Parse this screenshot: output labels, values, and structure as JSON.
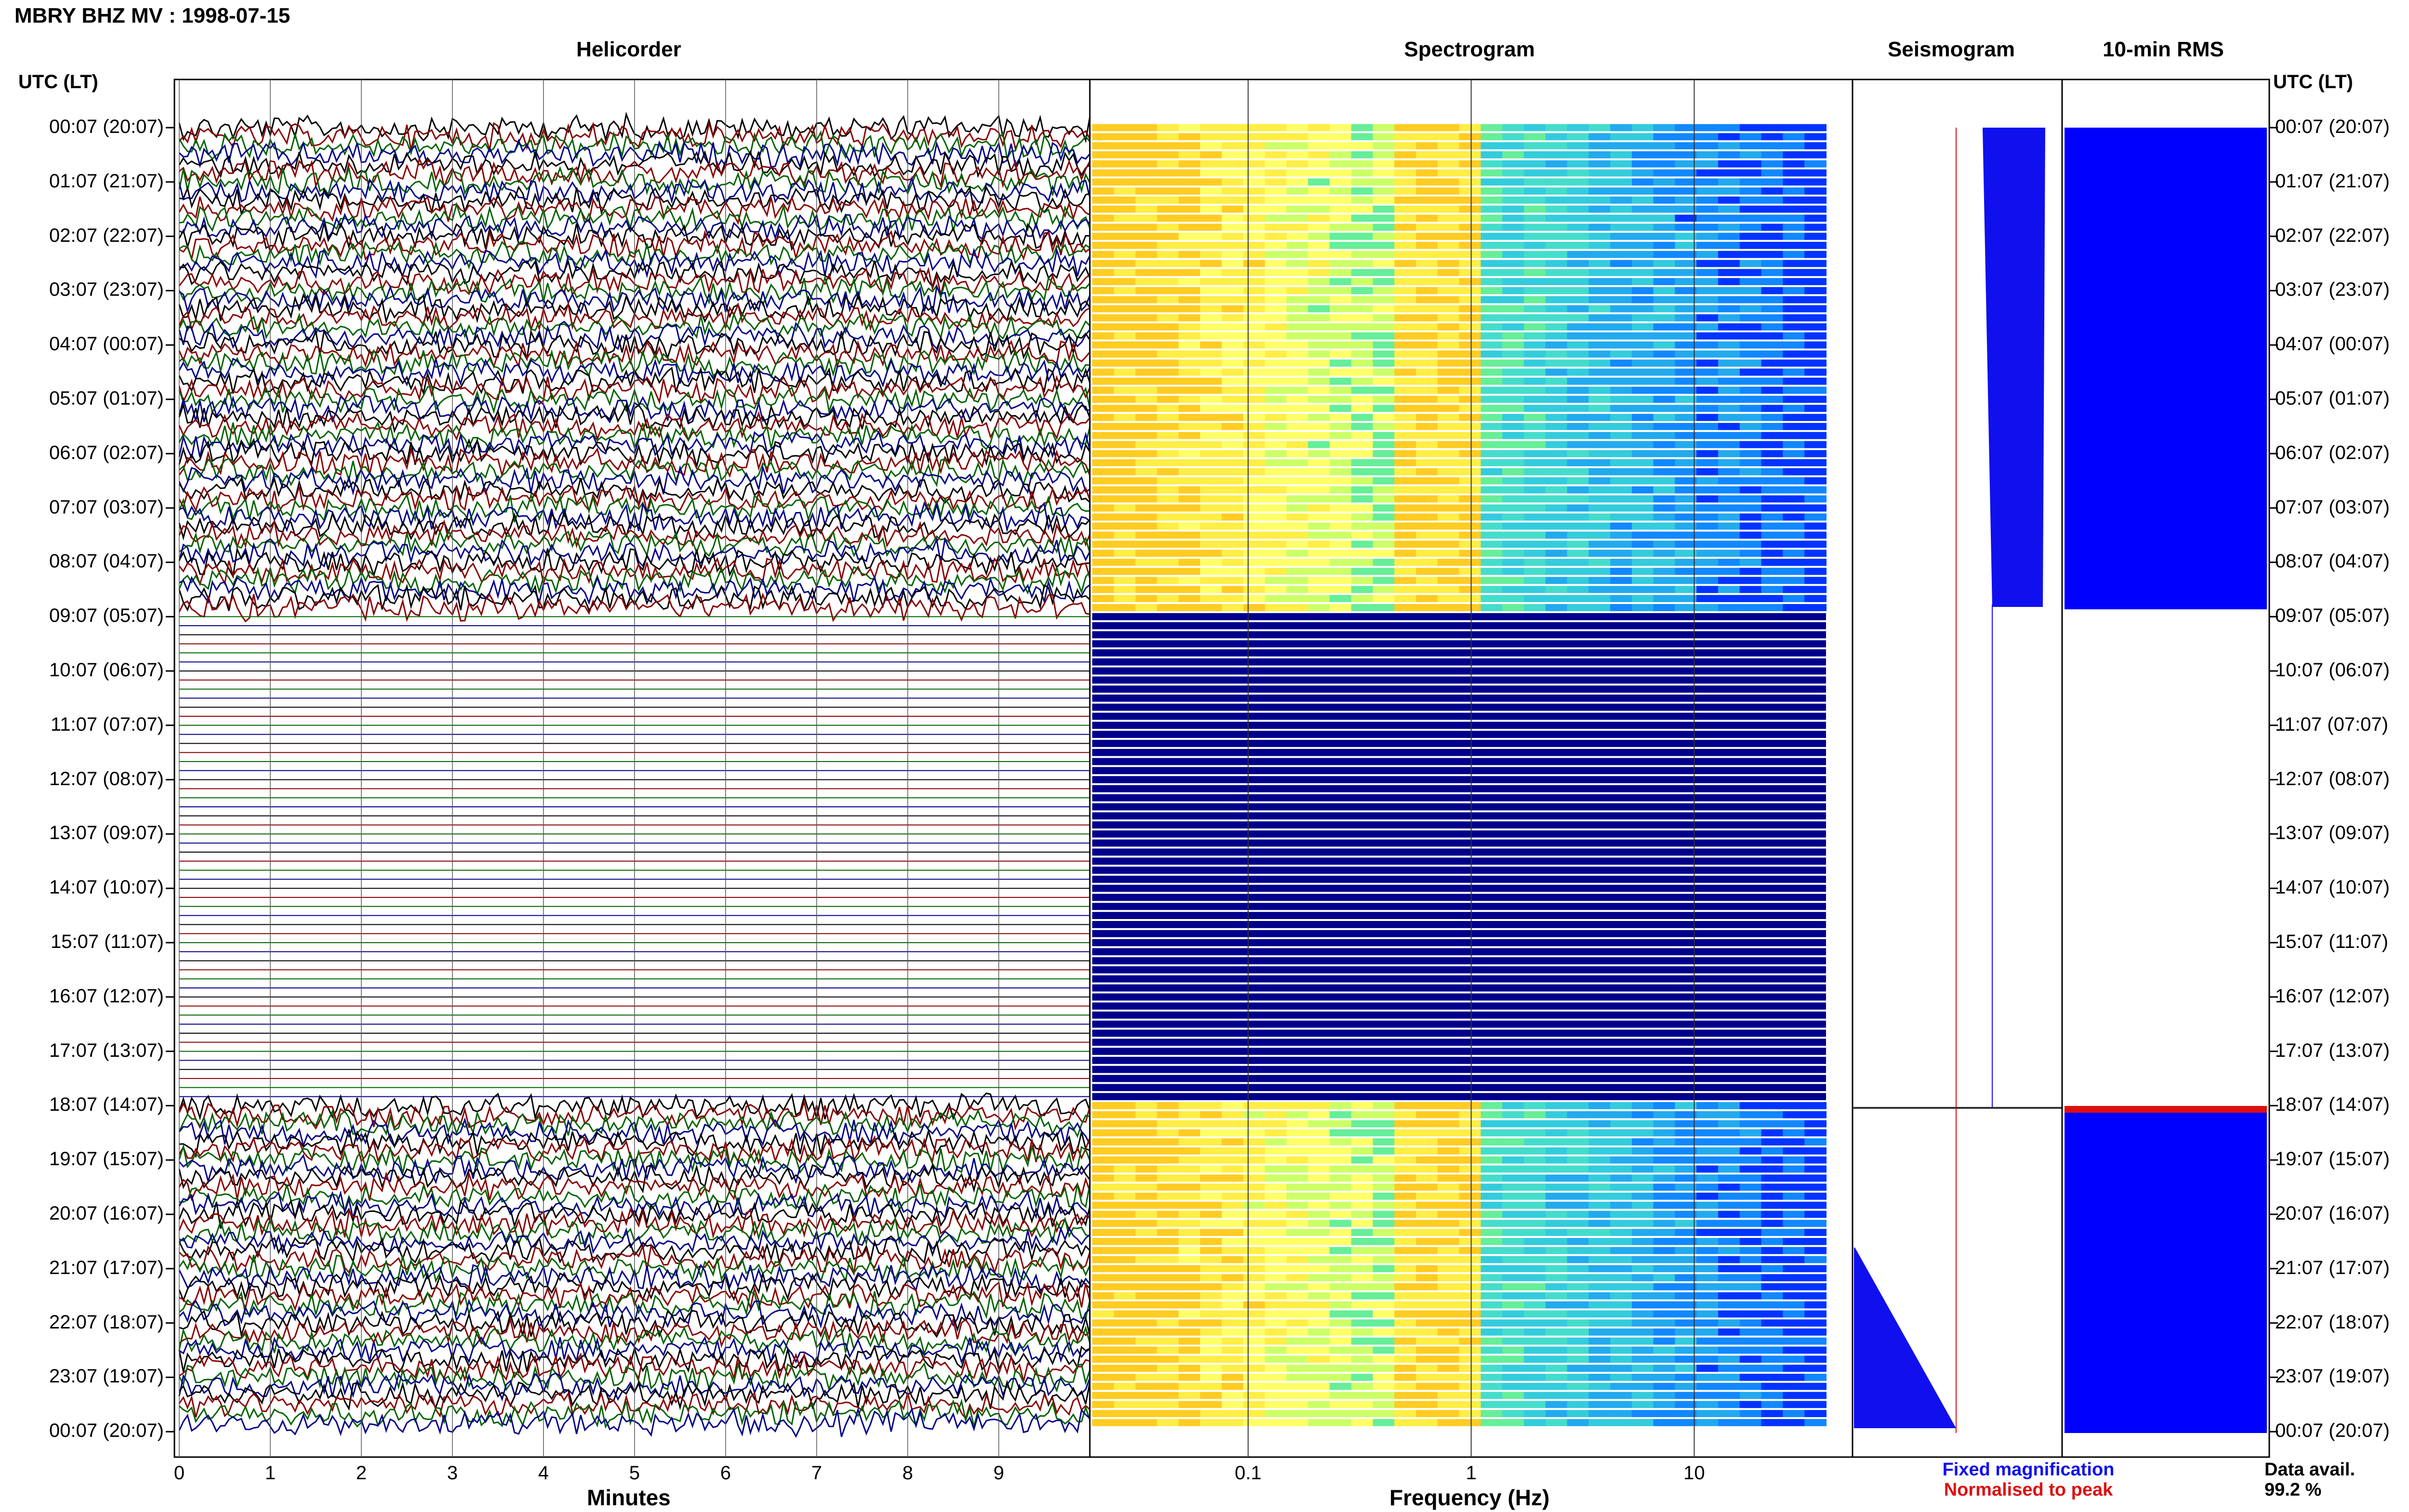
{
  "header": {
    "title": "MBRY BHZ MV : 1998-07-15",
    "corner_left": "UTC (LT)",
    "corner_right": "UTC (LT)"
  },
  "panels": {
    "helicorder": "Helicorder",
    "spectrogram": "Spectrogram",
    "seismogram": "Seismogram",
    "rms": "10-min RMS"
  },
  "legend": {
    "fixed": "Fixed magnification",
    "normalised": "Normalised to peak",
    "data_avail_label": "Data avail.",
    "data_avail_value": "99.2 %"
  },
  "colors": {
    "fixed": "#1010ee",
    "normalised": "#dd1010",
    "trace_colors": [
      "#000000",
      "#8b0000",
      "#006400",
      "#00008b"
    ],
    "spectrogram_gap": "#00008b",
    "rms_bar": "#0000ff"
  },
  "chart_data": [
    {
      "type": "line",
      "name": "helicorder",
      "title": "Helicorder",
      "xlabel": "Minutes",
      "x_ticks": [
        "0",
        "1",
        "2",
        "3",
        "4",
        "5",
        "6",
        "7",
        "8",
        "9"
      ],
      "xlim": [
        0,
        10
      ],
      "time_labels_utc_lt": [
        "00:07 (20:07)",
        "01:07 (21:07)",
        "02:07 (22:07)",
        "03:07 (23:07)",
        "04:07 (00:07)",
        "05:07 (01:07)",
        "06:07 (02:07)",
        "07:07 (03:07)",
        "08:07 (04:07)",
        "09:07 (05:07)",
        "10:07 (06:07)",
        "11:07 (07:07)",
        "12:07 (08:07)",
        "13:07 (09:07)",
        "14:07 (10:07)",
        "15:07 (11:07)",
        "16:07 (12:07)",
        "17:07 (13:07)",
        "18:07 (14:07)",
        "19:07 (15:07)",
        "20:07 (16:07)",
        "21:07 (17:07)",
        "22:07 (18:07)",
        "23:07 (19:07)",
        "00:07 (20:07)"
      ],
      "rows_per_hour": 6,
      "data_gap_hours": [
        9,
        18
      ]
    },
    {
      "type": "heatmap",
      "name": "spectrogram",
      "title": "Spectrogram",
      "xlabel": "Frequency (Hz)",
      "x_scale": "log",
      "x_ticks": [
        "0.1",
        "1",
        "10"
      ],
      "xlim": [
        0.02,
        50
      ],
      "data_gap_hours": [
        9,
        18
      ]
    },
    {
      "type": "line",
      "name": "seismogram",
      "title": "Seismogram",
      "series": [
        {
          "name": "Fixed magnification"
        },
        {
          "name": "Normalised to peak"
        }
      ]
    },
    {
      "type": "bar",
      "name": "rms",
      "title": "10-min RMS",
      "data_gap_hours": [
        9,
        18
      ]
    }
  ]
}
